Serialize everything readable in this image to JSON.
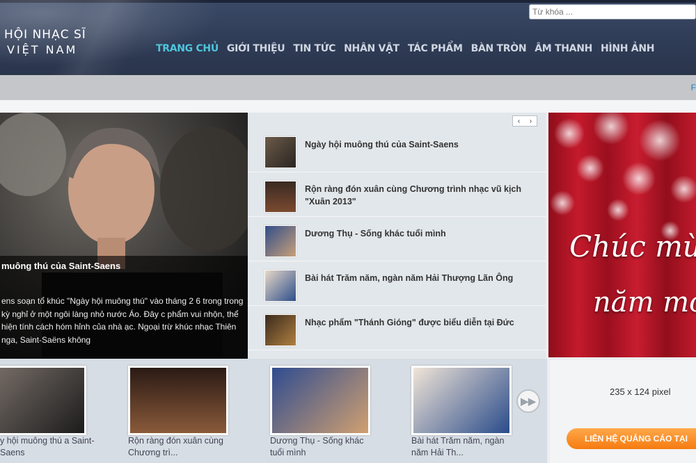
{
  "header": {
    "logo_line1": "HỘI NHẠC SĨ",
    "logo_line2": "VIỆT NAM",
    "search_placeholder": "Từ khóa ..."
  },
  "nav": {
    "items": [
      "TRANG CHỦ",
      "GIỚI THIỆU",
      "TIN TỨC",
      "NHÂN VẬT",
      "TÁC PHẨM",
      "BÀN TRÒN",
      "ÂM THANH",
      "HÌNH ẢNH"
    ],
    "active": "TRANG CHỦ"
  },
  "strip": {
    "right_text": "F"
  },
  "feature": {
    "title": "muông thú của Saint-Saens",
    "text": "ens soạn tổ khúc \"Ngày hội muông thú\" vào tháng 2 6 trong trong kỳ nghỉ ở một ngôi làng nhỏ nước Áo. Đây c phẩm vui nhộn, thể hiện tính cách hóm hỉnh của nhà ạc. Ngoại trừ khúc nhạc Thiên nga, Saint-Saëns không"
  },
  "pager": {
    "prev": "‹",
    "next": "›"
  },
  "news": [
    "Ngày hội muông thú của Saint-Saens",
    "Rộn ràng đón xuân cùng Chương trình nhạc vũ kịch \"Xuân 2013\"",
    "Dương Thụ - Sống khác tuổi mình",
    "Bài hát Trăm năm, ngàn năm Hải Thượng Lãn Ông",
    "Nhạc phẩm \"Thánh Gióng\" được biểu diễn tại Đức"
  ],
  "carousel": {
    "captions": [
      "y hội muông thú a Saint-Saens",
      "Rộn ràng đón xuân cùng Chương trì...",
      "Dương Thụ - Sống khác tuổi mình",
      "Bài hát Trăm năm, ngàn năm Hải Th..."
    ],
    "next_icon": "double-right-arrow"
  },
  "ad": {
    "line1": "Chúc mừn",
    "line2": "năm mớ",
    "size_text": "235 x 124 pixel",
    "button": "LIÊN HỆ QUẢNG CÁO TẠI"
  },
  "colors": {
    "nav_active": "#4fc6de",
    "header_bg": "#2f3c56",
    "ad_red": "#b31323",
    "button_orange": "#f57b10"
  }
}
